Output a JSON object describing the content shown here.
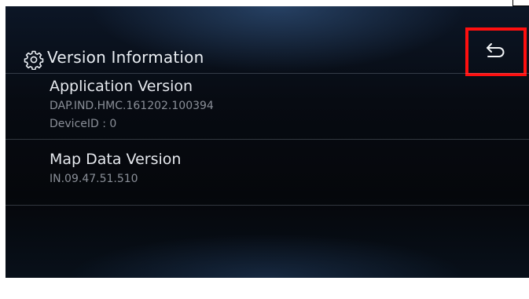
{
  "header": {
    "title": "Version Information",
    "settings_icon": "gear-icon",
    "back_icon": "back-arrow-icon"
  },
  "items": [
    {
      "title": "Application Version",
      "lines": [
        "DAP.IND.HMC.161202.100394",
        "DeviceID : 0"
      ]
    },
    {
      "title": "Map Data Version",
      "lines": [
        "IN.09.47.51.510"
      ]
    }
  ],
  "colors": {
    "highlight": "#ff0f0f",
    "title_text": "#e9edf2",
    "secondary_text": "#8a8f98",
    "background": "#070b12"
  }
}
